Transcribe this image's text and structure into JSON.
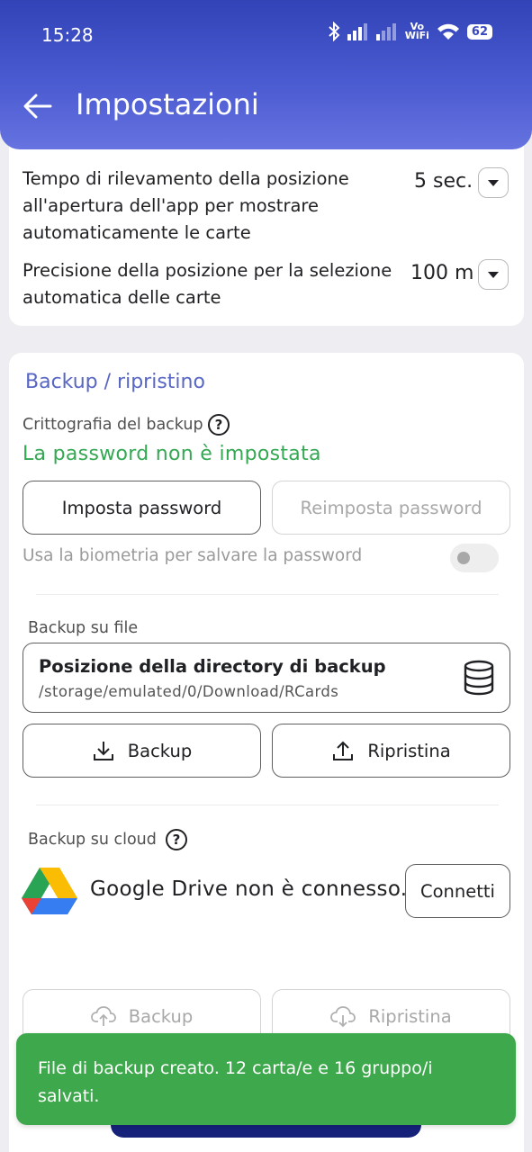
{
  "status_bar": {
    "time": "15:28",
    "vowifi_top": "Vo",
    "vowifi_bottom": "WiFi",
    "battery": "62"
  },
  "header": {
    "title": "Impostazioni"
  },
  "location_settings": {
    "timeout_label": "Tempo di rilevamento della posizione all'apertura dell'app per mostrare automaticamente le carte",
    "timeout_value": "5 sec.",
    "precision_label": "Precisione della posizione per la selezione automatica delle carte",
    "precision_value": "100 m"
  },
  "backup": {
    "section_title": "Backup / ripristino",
    "encryption_label": "Crittografia del backup",
    "password_status": "La password non è impostata",
    "set_password_label": "Imposta password",
    "reset_password_label": "Reimposta password",
    "biometric_label": "Usa la biometria per salvare la password",
    "file_backup_label": "Backup su file",
    "directory_title": "Posizione della directory di backup",
    "directory_path": "/storage/emulated/0/Download/RCards",
    "backup_label": "Backup",
    "restore_label": "Ripristina",
    "cloud_backup_label": "Backup su cloud",
    "gdrive_status": "Google Drive non è connesso.",
    "connect_label": "Connetti",
    "cloud_backup_btn": "Backup",
    "cloud_restore_btn": "Ripristina"
  },
  "toast": {
    "message": "File di backup creato. 12 carta/e e 16 gruppo/i salvati."
  },
  "colors": {
    "header": "#3a48bb",
    "accent": "#5866c4",
    "success": "#34a853",
    "toast": "#3ea84c"
  }
}
